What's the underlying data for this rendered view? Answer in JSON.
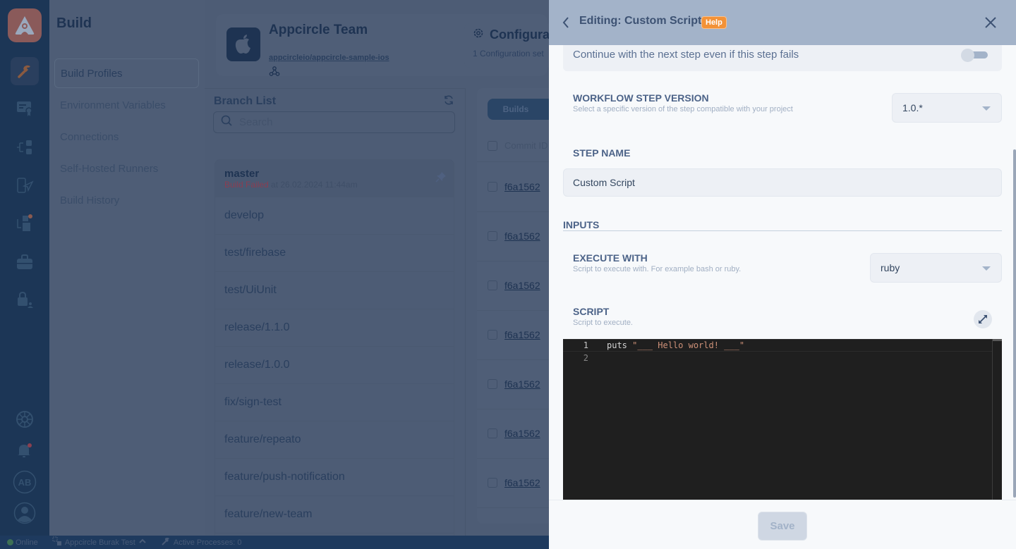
{
  "rail": {
    "icons": [
      "appcircle-logo-icon",
      "build-hammer-icon",
      "signing-certificate-icon",
      "testing-distribution-icon",
      "publish-icon",
      "store-submit-icon",
      "enterprise-store-icon",
      "lock-user-icon",
      "help-lifebuoy-icon",
      "notification-bell-icon",
      "avatar-initials",
      "profile-icon"
    ],
    "avatar_initials": "AB"
  },
  "subnav": {
    "title": "Build",
    "items": [
      {
        "label": "Build Profiles",
        "active": true
      },
      {
        "label": "Environment Variables"
      },
      {
        "label": "Connections"
      },
      {
        "label": "Self-Hosted Runners"
      },
      {
        "label": "Build History"
      }
    ]
  },
  "project": {
    "title": "Appcircle Team",
    "repo": "appcircleio/appcircle-sample-ios",
    "config_title": "Configura",
    "config_subtitle": "1 Configuration set"
  },
  "branches": {
    "title": "Branch List",
    "search_placeholder": "Search",
    "items": [
      {
        "name": "master",
        "status": "Build Failed",
        "status_suffix": " at 26.02.2024 11:44am"
      },
      {
        "name": "develop"
      },
      {
        "name": "test/firebase"
      },
      {
        "name": "test/UiUnit"
      },
      {
        "name": "release/1.1.0"
      },
      {
        "name": "release/1.0.0"
      },
      {
        "name": "fix/sign-test"
      },
      {
        "name": "feature/repeato"
      },
      {
        "name": "feature/push-notification"
      },
      {
        "name": "feature/new-team"
      }
    ]
  },
  "builds": {
    "tab_label": "Builds",
    "header_commit": "Commit ID",
    "commits": [
      "f6a1562",
      "f6a1562",
      "f6a1562",
      "f6a1562",
      "f6a1562",
      "f6a1562",
      "f6a1562"
    ]
  },
  "statusbar": {
    "online": "Online",
    "org": "Appcircle Burak Test",
    "processes": "Active Processes: 0"
  },
  "panel": {
    "title": "Editing: Custom Script",
    "help_badge": "Help",
    "continue_label": "Continue with the next step even if this step fails",
    "continue_on_fail": false,
    "version": {
      "label": "WORKFLOW STEP VERSION",
      "help": "Select a specific version of the step compatible with your project",
      "value": "1.0.*"
    },
    "step_name": {
      "label": "STEP NAME",
      "value": "Custom Script"
    },
    "inputs_heading": "INPUTS",
    "execute_with": {
      "label": "EXECUTE WITH",
      "help": "Script to execute with. For example bash or ruby.",
      "value": "ruby"
    },
    "script": {
      "label": "SCRIPT",
      "help": "Script to execute.",
      "lines": [
        {
          "num": "1",
          "keyword": "puts ",
          "string": "\"___ Hello world! ___\""
        },
        {
          "num": "2",
          "keyword": "",
          "string": ""
        }
      ]
    },
    "save_label": "Save"
  }
}
